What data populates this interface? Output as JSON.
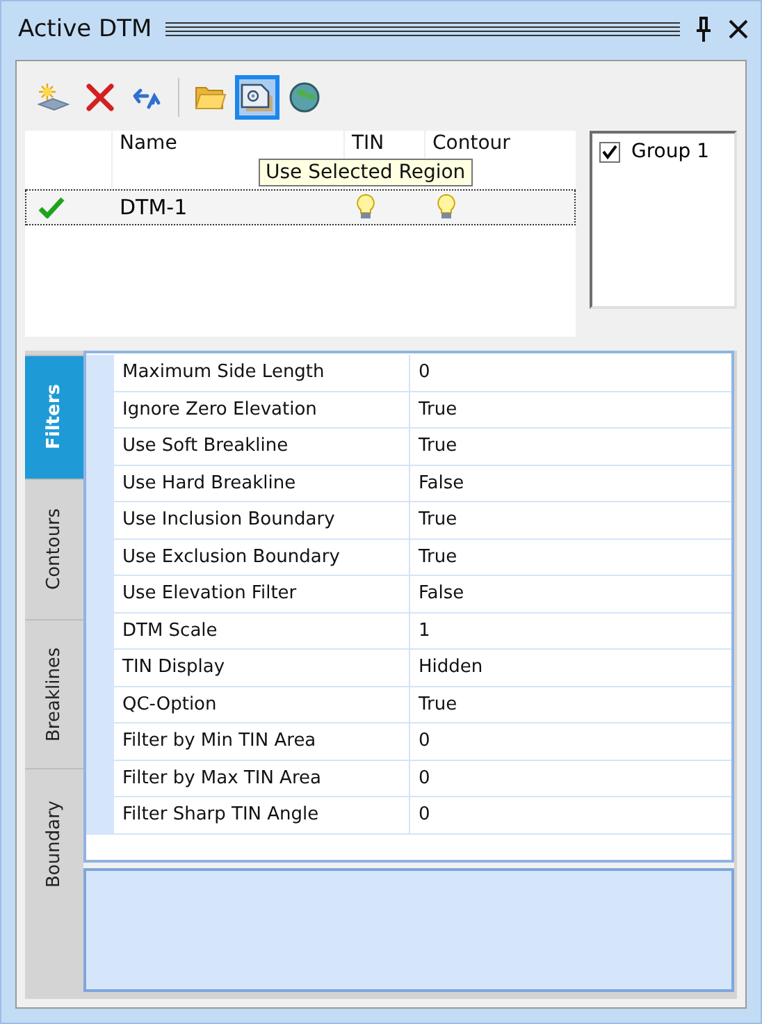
{
  "window": {
    "title": "Active DTM"
  },
  "toolbar": [
    {
      "kind": "new",
      "selected": false
    },
    {
      "kind": "delete",
      "selected": false
    },
    {
      "kind": "refresh",
      "selected": false
    },
    {
      "kind": "separator"
    },
    {
      "kind": "folder",
      "selected": false
    },
    {
      "kind": "region",
      "selected": true
    },
    {
      "kind": "globe",
      "selected": false
    }
  ],
  "tooltip": "Use Selected Region",
  "dtm_table": {
    "columns": [
      "Name",
      "TIN",
      "Contour"
    ],
    "rows": [
      {
        "active": true,
        "name": "DTM-1",
        "tin_on": true,
        "contour_on": true,
        "selected": true
      }
    ]
  },
  "groups": [
    {
      "label": "Group 1",
      "checked": true
    }
  ],
  "tabs": [
    {
      "label": "Filters",
      "selected": true
    },
    {
      "label": "Contours",
      "selected": false
    },
    {
      "label": "Breaklines",
      "selected": false
    },
    {
      "label": "Boundary",
      "selected": false
    }
  ],
  "properties": [
    {
      "name": "Maximum Side Length",
      "value": "0"
    },
    {
      "name": "Ignore Zero Elevation",
      "value": "True"
    },
    {
      "name": "Use Soft Breakline",
      "value": "True"
    },
    {
      "name": "Use Hard Breakline",
      "value": "False"
    },
    {
      "name": "Use Inclusion Boundary",
      "value": "True"
    },
    {
      "name": "Use Exclusion Boundary",
      "value": "True"
    },
    {
      "name": "Use Elevation Filter",
      "value": "False"
    },
    {
      "name": "DTM Scale",
      "value": "1"
    },
    {
      "name": "TIN Display",
      "value": "Hidden"
    },
    {
      "name": "QC-Option",
      "value": "True"
    },
    {
      "name": "Filter by Min TIN Area",
      "value": "0"
    },
    {
      "name": "Filter by Max TIN Area",
      "value": "0"
    },
    {
      "name": "Filter Sharp TIN Angle",
      "value": "0"
    }
  ]
}
